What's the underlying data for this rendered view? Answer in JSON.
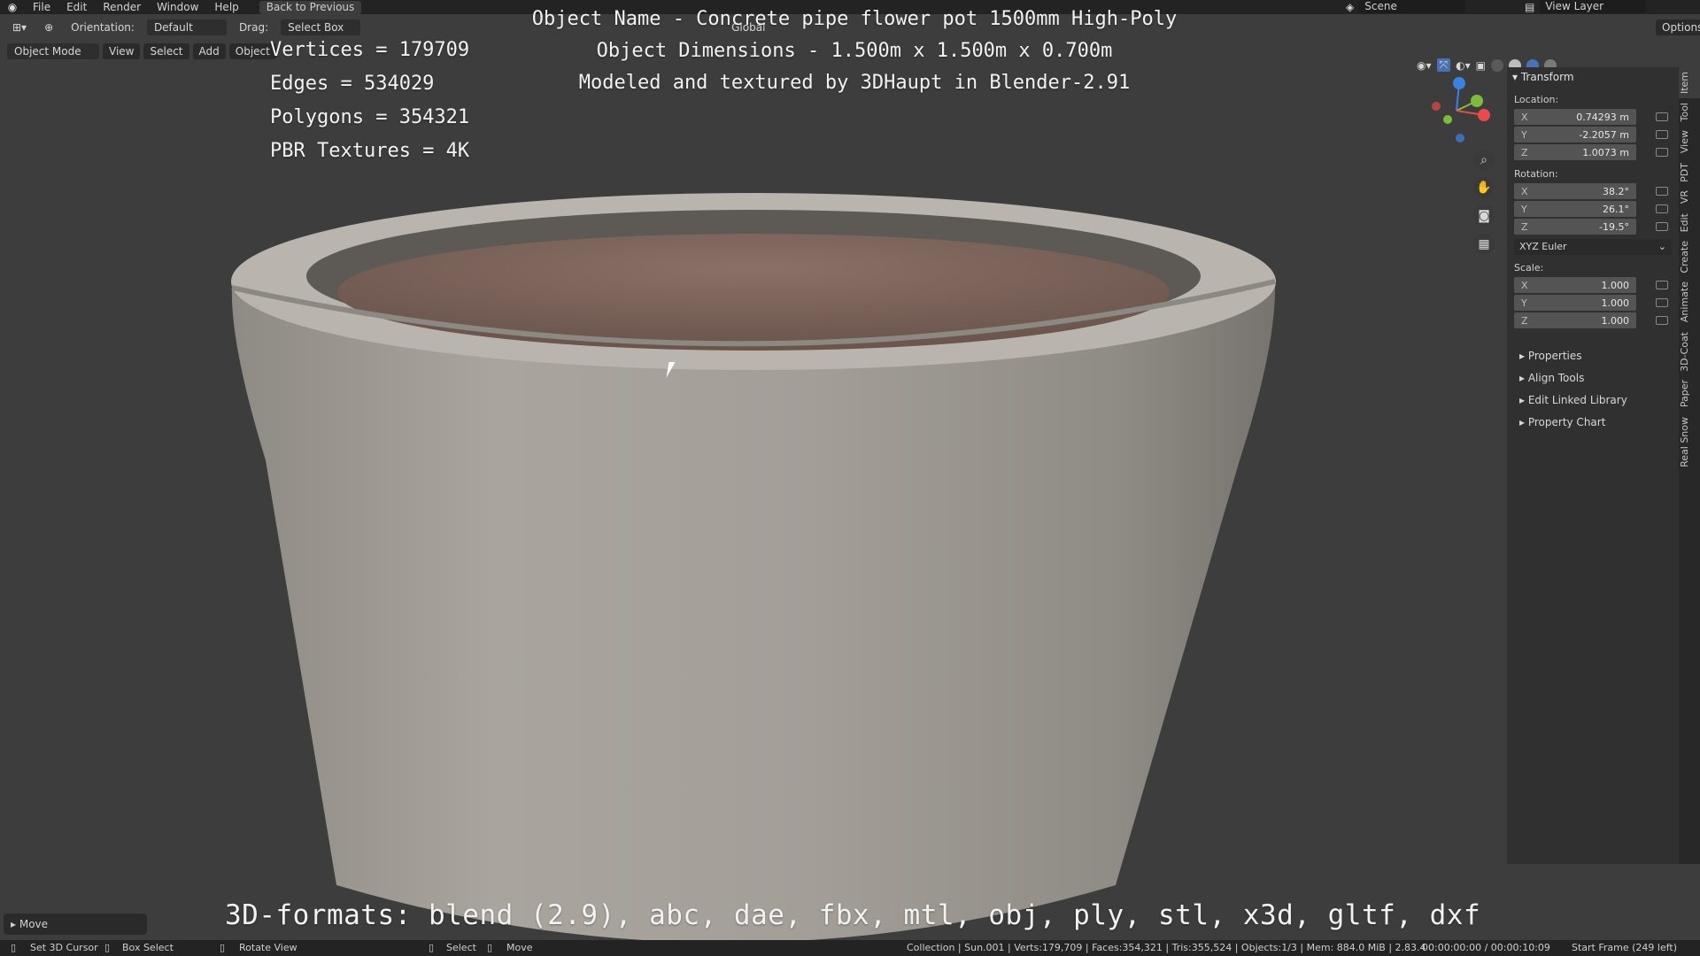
{
  "topbar": {
    "menu": [
      "File",
      "Edit",
      "Render",
      "Window",
      "Help"
    ],
    "back_button": "Back to Previous",
    "scene_label": "Scene",
    "view_layer_label": "View Layer"
  },
  "header": {
    "orientation_label": "Orientation:",
    "orientation_value": "Default",
    "drag_label": "Drag:",
    "drag_value": "Select Box",
    "transform_space": "Global",
    "options_label": "Options",
    "mode": "Object Mode",
    "menus": [
      "View",
      "Select",
      "Add",
      "Object"
    ]
  },
  "overlay_stats": {
    "vertices": "Vertices = 179709",
    "edges": "Edges = 534029",
    "polygons": "Polygons = 354321",
    "textures": "PBR Textures = 4K"
  },
  "overlay_info": {
    "name": "Object Name - Concrete pipe flower pot 1500mm High-Poly",
    "dimensions": "Object Dimensions -  1.500m x 1.500m x 0.700m",
    "credit": "Modeled and textured by 3DHaupt in Blender-2.91"
  },
  "overlay_formats": "3D-formats: blend (2.9), abc, dae, fbx, mtl, obj, ply, stl, x3d, gltf, dxf",
  "transform": {
    "title": "Transform",
    "location_label": "Location:",
    "location": [
      {
        "axis": "X",
        "value": "0.74293 m"
      },
      {
        "axis": "Y",
        "value": "-2.2057 m"
      },
      {
        "axis": "Z",
        "value": "1.0073 m"
      }
    ],
    "rotation_label": "Rotation:",
    "rotation": [
      {
        "axis": "X",
        "value": "38.2°"
      },
      {
        "axis": "Y",
        "value": "26.1°"
      },
      {
        "axis": "Z",
        "value": "-19.5°"
      }
    ],
    "rotation_mode": "XYZ Euler",
    "scale_label": "Scale:",
    "scale": [
      {
        "axis": "X",
        "value": "1.000"
      },
      {
        "axis": "Y",
        "value": "1.000"
      },
      {
        "axis": "Z",
        "value": "1.000"
      }
    ]
  },
  "collapsed_panels": [
    "Properties",
    "Align Tools",
    "Edit Linked Library",
    "Property Chart"
  ],
  "side_tabs": [
    "Item",
    "Tool",
    "View",
    "PDT",
    "VR",
    "Edit",
    "Create",
    "Animate",
    "3D-Coat",
    "Paper",
    "Real Snow"
  ],
  "last_operator": "Move",
  "statusbar": {
    "set_cursor": "Set 3D Cursor",
    "box_select": "Box Select",
    "rotate_view": "Rotate View",
    "select": "Select",
    "move": "Move",
    "scene_stats": "Collection | Sun.001 | Verts:179,709 | Faces:354,321 | Tris:355,524 | Objects:1/3 | Mem: 884.0 MiB | 2.83.4",
    "timecode": "00:00:00:00 / 00:00:10:09",
    "frame_info": "Start Frame (249 left)"
  },
  "colors": {
    "background": "#3d3d3d",
    "pot_concrete": "#a29e97",
    "soil": "#7b6359",
    "axis_x": "#e94a4a",
    "axis_y": "#7dbd3a",
    "axis_z": "#3b82e0"
  }
}
